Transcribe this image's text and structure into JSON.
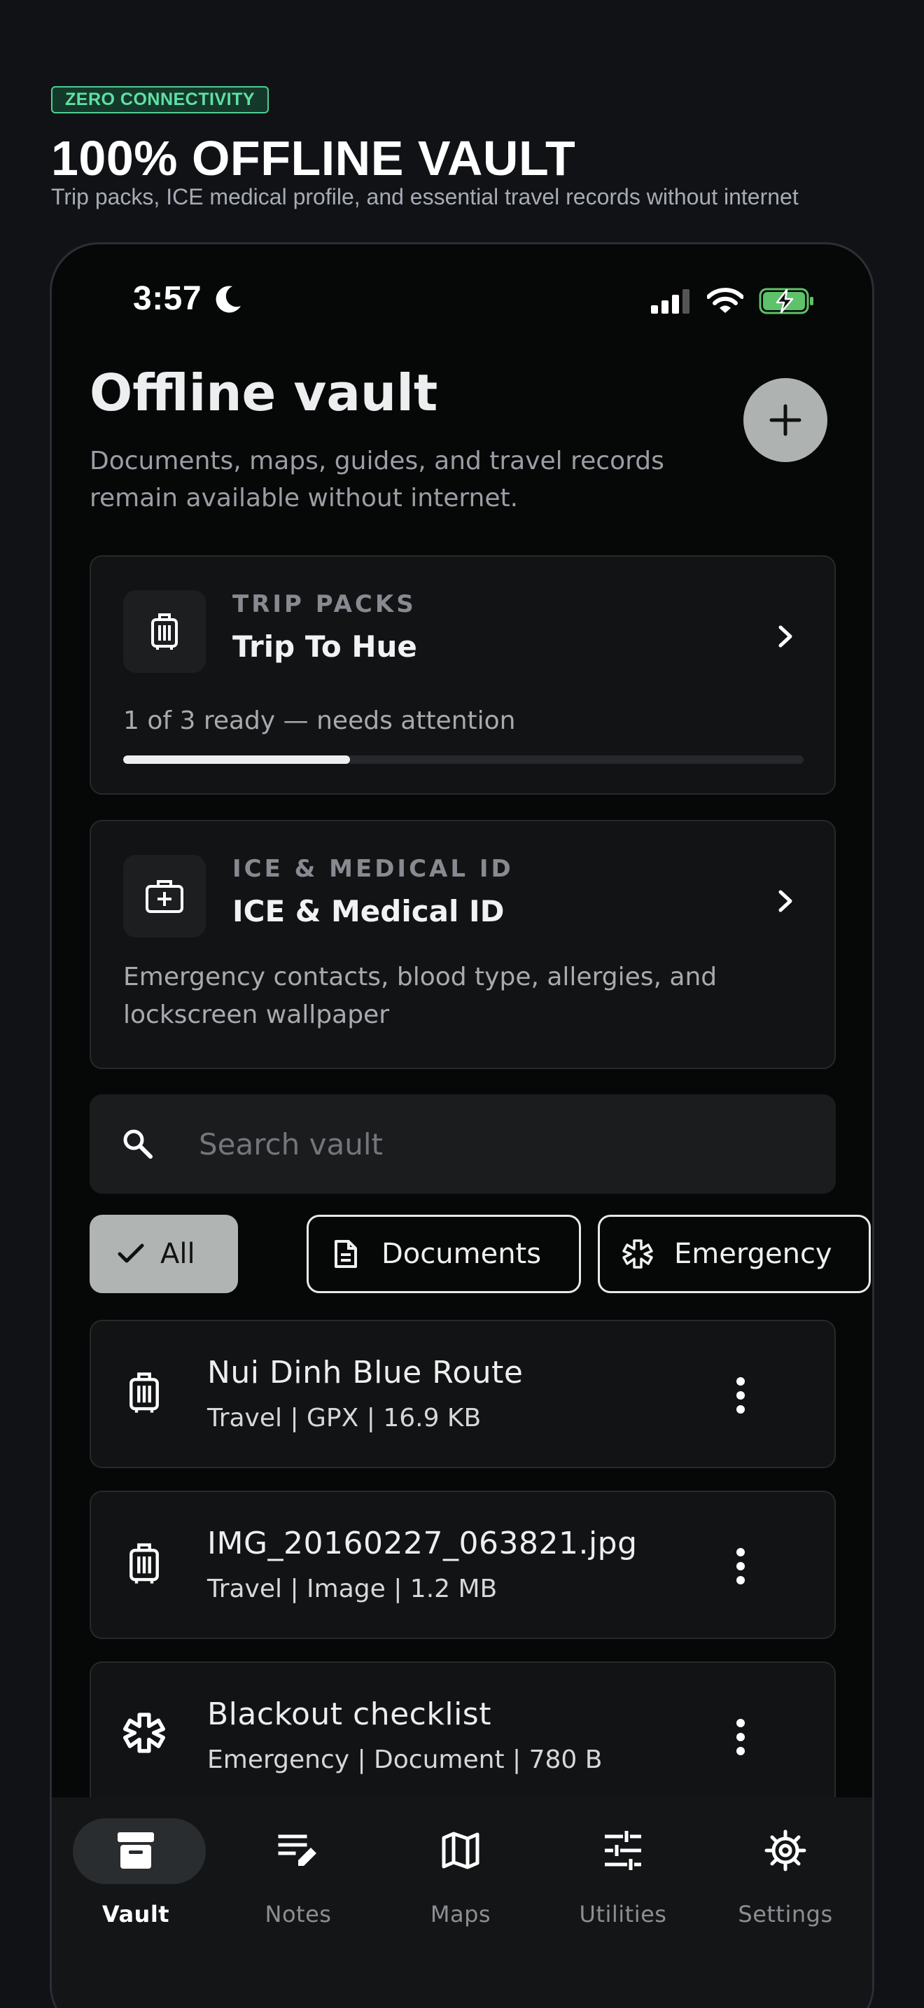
{
  "marketing": {
    "badge": "ZERO CONNECTIVITY",
    "title": "100% OFFLINE VAULT",
    "subtitle": "Trip packs, ICE medical profile, and essential travel records without internet"
  },
  "status_bar": {
    "time": "3:57",
    "icons": [
      "moon-icon",
      "signal-icon",
      "wifi-icon",
      "battery-charging-icon"
    ]
  },
  "header": {
    "title": "Offline vault",
    "subtitle": "Documents, maps, guides, and travel records remain available without internet.",
    "add_icon": "plus-icon"
  },
  "trip_card": {
    "eyebrow": "TRIP PACKS",
    "title": "Trip To Hue",
    "status": "1 of 3 ready — needs attention",
    "progress_fraction": 0.333,
    "icon": "luggage-icon"
  },
  "ice_card": {
    "eyebrow": "ICE & MEDICAL ID",
    "title": "ICE & Medical ID",
    "description": "Emergency contacts, blood type, allergies, and lockscreen wallpaper",
    "icon": "medical-kit-icon"
  },
  "search": {
    "placeholder": "Search vault",
    "value": ""
  },
  "filters": [
    {
      "label": "All",
      "icon": "check-icon",
      "selected": true
    },
    {
      "label": "Documents",
      "icon": "document-icon",
      "selected": false
    },
    {
      "label": "Emergency",
      "icon": "asterisk-icon",
      "selected": false
    }
  ],
  "items": [
    {
      "title": "Nui Dinh Blue Route",
      "meta": "Travel | GPX | 16.9 KB",
      "icon": "luggage-icon"
    },
    {
      "title": "IMG_20160227_063821.jpg",
      "meta": "Travel | Image | 1.2 MB",
      "icon": "luggage-icon"
    },
    {
      "title": "Blackout checklist",
      "meta": "Emergency | Document | 780 B",
      "icon": "asterisk-icon"
    }
  ],
  "nav": [
    {
      "label": "Vault",
      "icon": "archive-box-icon",
      "active": true
    },
    {
      "label": "Notes",
      "icon": "notes-edit-icon",
      "active": false
    },
    {
      "label": "Maps",
      "icon": "map-icon",
      "active": false
    },
    {
      "label": "Utilities",
      "icon": "sliders-icon",
      "active": false
    },
    {
      "label": "Settings",
      "icon": "gear-icon",
      "active": false
    }
  ],
  "colors": {
    "badge_green": "#5fe0a4",
    "background": "#060707",
    "card": "#121314",
    "chip_selected": "#b0b5b3",
    "fab": "#aeb3b1",
    "battery_green": "#5ec26a"
  }
}
